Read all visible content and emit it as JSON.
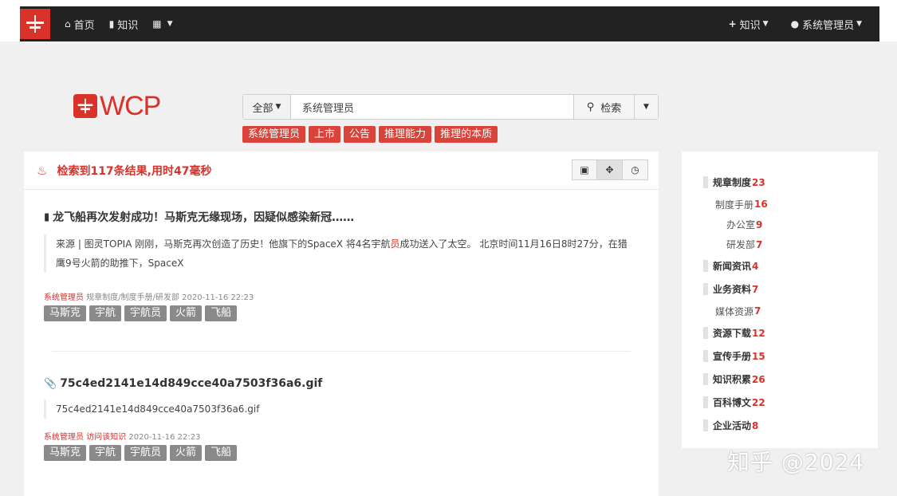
{
  "colors": {
    "brand": "#d9322b",
    "navbar": "#222222",
    "tag_gray": "#8a8a8a"
  },
  "nav": {
    "home": "首页",
    "knowledge": "知识",
    "apps_icon": "grid-icon",
    "add_knowledge": "知识",
    "user": "系统管理员"
  },
  "logo": {
    "text": "WCP"
  },
  "search": {
    "scope": "全部",
    "value": "系统管理员",
    "button": "检索"
  },
  "hot_tags": [
    "系统管理员",
    "上市",
    "公告",
    "推理能力",
    "推理的本质"
  ],
  "results": {
    "summary": "检索到117条结果,用时47毫秒",
    "items": [
      {
        "title": "龙飞船再次发射成功！马斯克无缘现场，因疑似感染新冠……",
        "icon": "document-icon",
        "quote_pre": "来源 | 图灵TOPIA 刚刚，马斯克再次创造了历史！他旗下的SpaceX 将4名宇航",
        "quote_hl": "员",
        "quote_post": "成功送入了太空。 北京时间11月16日8时27分，在猎鹰9号火箭的助推下，SpaceX",
        "author": "系统管理员",
        "path": "规章制度/制度手册/研发部",
        "time": "2020-11-16 22:23",
        "tags": [
          "马斯克",
          "宇航",
          "宇航员",
          "火箭",
          "飞船"
        ]
      },
      {
        "title": "75c4ed2141e14d849cce40a7503f36a6.gif",
        "icon": "paperclip-icon",
        "quote": "75c4ed2141e14d849cce40a7503f36a6.gif",
        "author": "系统管理员",
        "path": "访问该知识",
        "time": "2020-11-16 22:23",
        "tags": [
          "马斯克",
          "宇航",
          "宇航员",
          "火箭",
          "飞船"
        ]
      }
    ]
  },
  "categories": [
    {
      "level": 1,
      "name": "规章制度",
      "count": "23"
    },
    {
      "level": 2,
      "name": "制度手册",
      "count": "16"
    },
    {
      "level": 3,
      "name": "办公室",
      "count": "9"
    },
    {
      "level": 3,
      "name": "研发部",
      "count": "7"
    },
    {
      "level": 1,
      "name": "新闻资讯",
      "count": "4"
    },
    {
      "level": 1,
      "name": "业务资料",
      "count": "7"
    },
    {
      "level": 2,
      "name": "媒体资源",
      "count": "7"
    },
    {
      "level": 1,
      "name": "资源下载",
      "count": "12"
    },
    {
      "level": 1,
      "name": "宣传手册",
      "count": "15"
    },
    {
      "level": 1,
      "name": "知识积累",
      "count": "26"
    },
    {
      "level": 1,
      "name": "百科博文",
      "count": "22"
    },
    {
      "level": 1,
      "name": "企业活动",
      "count": "8"
    }
  ],
  "watermark": "知乎 @2024"
}
